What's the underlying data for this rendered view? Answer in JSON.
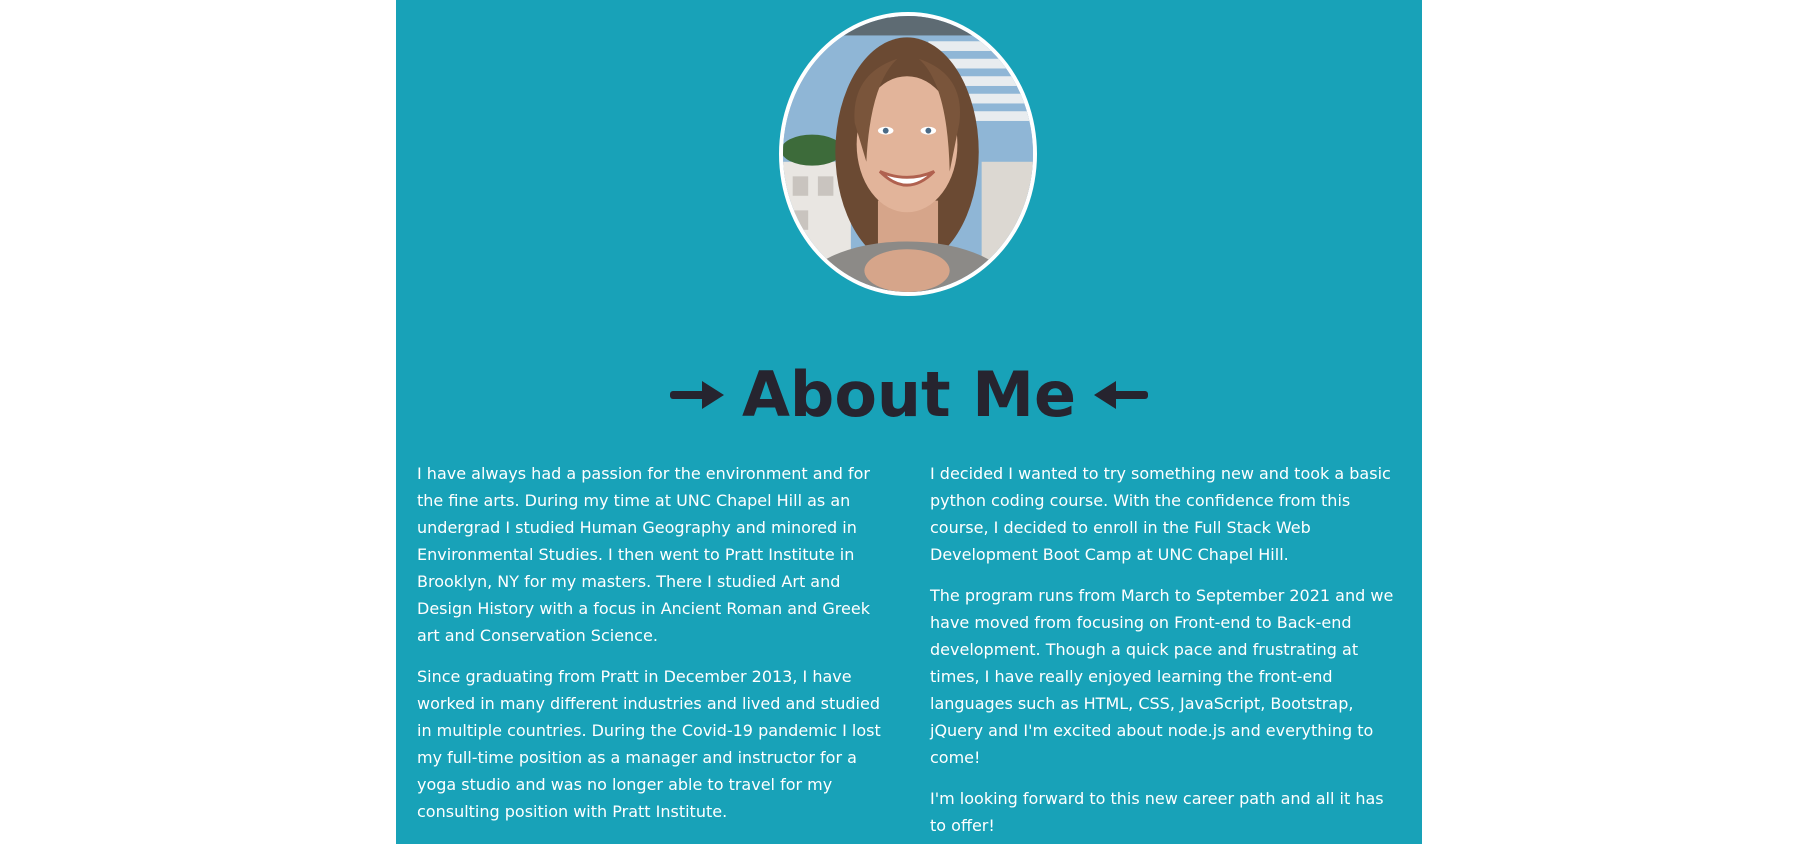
{
  "about": {
    "title": "About Me",
    "left_paragraphs": [
      "I have always had a passion for the environment and for the fine arts. During my time at UNC Chapel Hill as an undergrad I studied Human Geography and minored in Environmental Studies. I then went to Pratt Institute in Brooklyn, NY for my masters. There I studied Art and Design History with a focus in Ancient Roman and Greek art and Conservation Science.",
      "Since graduating from Pratt in December 2013, I have worked in many different industries and lived and studied in multiple countries. During the Covid-19 pandemic I lost my full-time position as a manager and instructor for a yoga studio and was no longer able to travel for my consulting position with Pratt Institute."
    ],
    "right_paragraphs": [
      "I decided I wanted to try something new and took a basic python coding course. With the confidence from this course, I decided to enroll in the Full Stack Web Development Boot Camp at UNC Chapel Hill.",
      "The program runs from March to September 2021 and we have moved from focusing on Front-end to Back-end development. Though a quick pace and frustrating at times, I have really enjoyed learning the front-end languages such as HTML, CSS, JavaScript, Bootstrap, jQuery and I'm excited about node.js and everything to come!",
      "I'm looking forward to this new career path and all it has to offer!"
    ]
  },
  "icons": {
    "left_arrow": "arrow-right-icon",
    "right_arrow": "arrow-left-icon"
  },
  "colors": {
    "panel_background": "#18a2b8",
    "heading_text": "#26242f",
    "body_text": "#ffffff",
    "page_background": "#ffffff",
    "avatar_border": "#ffffff"
  }
}
